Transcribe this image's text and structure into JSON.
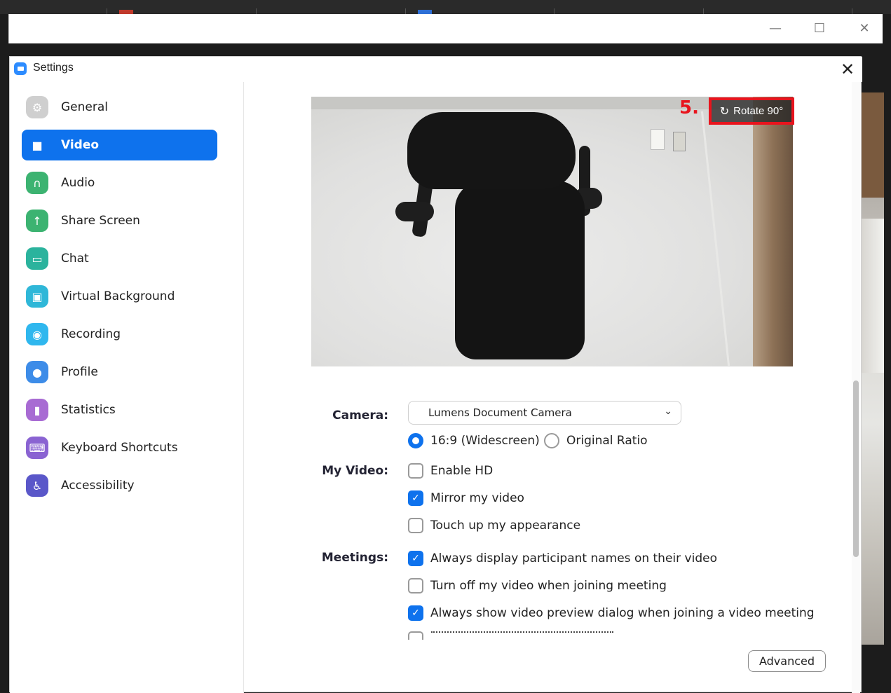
{
  "window": {
    "title": "Settings",
    "controls": {
      "minimize": "—",
      "maximize": "☐",
      "close": "✕"
    }
  },
  "sidebar": {
    "items": [
      {
        "label": "General",
        "icon": "gear-icon",
        "color": "#cfcfcf",
        "glyph": "⚙"
      },
      {
        "label": "Video",
        "icon": "video-camera-icon",
        "color": "#0e72ed",
        "glyph": "■"
      },
      {
        "label": "Audio",
        "icon": "headphones-icon",
        "color": "#3cb371",
        "glyph": "∩"
      },
      {
        "label": "Share Screen",
        "icon": "share-screen-icon",
        "color": "#3cb371",
        "glyph": "↑"
      },
      {
        "label": "Chat",
        "icon": "chat-bubble-icon",
        "color": "#2bb39d",
        "glyph": "▭"
      },
      {
        "label": "Virtual Background",
        "icon": "virtual-background-icon",
        "color": "#2fb7d8",
        "glyph": "▣"
      },
      {
        "label": "Recording",
        "icon": "recording-icon",
        "color": "#2fb7ee",
        "glyph": "◉"
      },
      {
        "label": "Profile",
        "icon": "profile-icon",
        "color": "#3d8ce8",
        "glyph": "●"
      },
      {
        "label": "Statistics",
        "icon": "statistics-icon",
        "color": "#a86bd3",
        "glyph": "▮"
      },
      {
        "label": "Keyboard Shortcuts",
        "icon": "keyboard-icon",
        "color": "#8a63d2",
        "glyph": "⌨"
      },
      {
        "label": "Accessibility",
        "icon": "accessibility-icon",
        "color": "#5a57c9",
        "glyph": "♿"
      }
    ],
    "active_index": 1
  },
  "preview": {
    "step_label": "5.",
    "rotate_label": "Rotate 90°",
    "rotate_icon": "rotate-icon"
  },
  "camera": {
    "label": "Camera:",
    "selected": "Lumens Document Camera",
    "ratio_options": [
      {
        "label": "16:9 (Widescreen)",
        "selected": true
      },
      {
        "label": "Original Ratio",
        "selected": false
      }
    ]
  },
  "my_video": {
    "label": "My Video:",
    "options": [
      {
        "label": "Enable HD",
        "checked": false
      },
      {
        "label": "Mirror my video",
        "checked": true
      },
      {
        "label": "Touch up my appearance",
        "checked": false
      }
    ]
  },
  "meetings": {
    "label": "Meetings:",
    "options": [
      {
        "label": "Always display participant names on their video",
        "checked": true
      },
      {
        "label": "Turn off my video when joining meeting",
        "checked": false
      },
      {
        "label": "Always show video preview dialog when joining a video meeting",
        "checked": true
      }
    ]
  },
  "advanced_button": "Advanced",
  "colors": {
    "accent": "#0e72ed",
    "annotation_red": "#e8141d"
  }
}
